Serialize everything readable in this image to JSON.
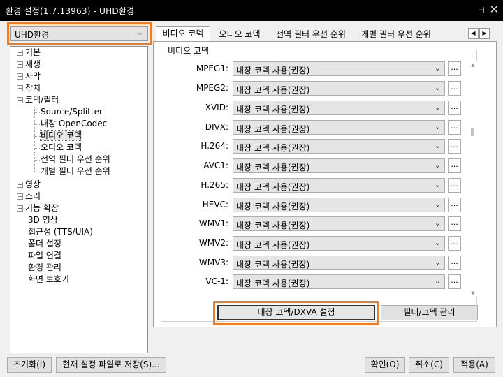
{
  "window": {
    "title": "환경 설정(1.7.13963) - UHD환경",
    "pin_icon": "pin-icon",
    "close_icon": "close-icon"
  },
  "accent_color": "#f07c1f",
  "profile": {
    "selected": "UHD환경"
  },
  "tree": {
    "items": [
      {
        "label": "기본",
        "expander": "+"
      },
      {
        "label": "재생",
        "expander": "+"
      },
      {
        "label": "자막",
        "expander": "+"
      },
      {
        "label": "장치",
        "expander": "+"
      },
      {
        "label": "코덱/필터",
        "expander": "−"
      },
      {
        "label": "Source/Splitter"
      },
      {
        "label": "내장 OpenCodec"
      },
      {
        "label": "비디오 코덱"
      },
      {
        "label": "오디오 코덱"
      },
      {
        "label": "전역 필터 우선 순위"
      },
      {
        "label": "개별 필터 우선 순위"
      },
      {
        "label": "영상",
        "expander": "+"
      },
      {
        "label": "소리",
        "expander": "+"
      },
      {
        "label": "기능 확장",
        "expander": "+"
      },
      {
        "label": "3D 영상"
      },
      {
        "label": "접근성 (TTS/UIA)"
      },
      {
        "label": "폴더 설정"
      },
      {
        "label": "파일 연결"
      },
      {
        "label": "환경 관리"
      },
      {
        "label": "화면 보호기"
      }
    ]
  },
  "tabs": [
    {
      "label": "비디오 코덱"
    },
    {
      "label": "오디오 코덱"
    },
    {
      "label": "전역 필터 우선 순위"
    },
    {
      "label": "개별 필터 우선 순위"
    }
  ],
  "tab_scroll": {
    "left": "◀",
    "right": "▶"
  },
  "video_codec": {
    "group_label": "비디오 코덱",
    "rows": [
      {
        "label": "MPEG1:",
        "value": "내장 코덱 사용(권장)"
      },
      {
        "label": "MPEG2:",
        "value": "내장 코덱 사용(권장)"
      },
      {
        "label": "XVID:",
        "value": "내장 코덱 사용(권장)"
      },
      {
        "label": "DIVX:",
        "value": "내장 코덱 사용(권장)"
      },
      {
        "label": "H.264:",
        "value": "내장 코덱 사용(권장)"
      },
      {
        "label": "AVC1:",
        "value": "내장 코덱 사용(권장)"
      },
      {
        "label": "H.265:",
        "value": "내장 코덱 사용(권장)"
      },
      {
        "label": "HEVC:",
        "value": "내장 코덱 사용(권장)"
      },
      {
        "label": "WMV1:",
        "value": "내장 코덱 사용(권장)"
      },
      {
        "label": "WMV2:",
        "value": "내장 코덱 사용(권장)"
      },
      {
        "label": "WMV3:",
        "value": "내장 코덱 사용(권장)"
      },
      {
        "label": "VC-1:",
        "value": "내장 코덱 사용(권장)"
      }
    ],
    "more_label": "...",
    "dropdown_arrow": "⌄",
    "internal_codec_button": "내장 코덱/DXVA 설정",
    "filter_manage_button": "필터/코덱 관리"
  },
  "footer": {
    "reset": "초기화(I)",
    "save_file": "현재 설정 파일로 저장(S)...",
    "ok": "확인(O)",
    "cancel": "취소(C)",
    "apply": "적용(A)"
  }
}
